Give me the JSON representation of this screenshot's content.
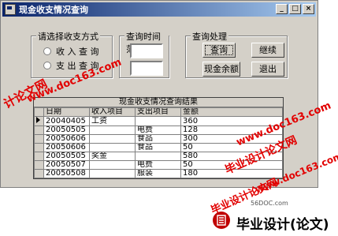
{
  "window": {
    "title": "现金收支情况查询"
  },
  "controls": {
    "minimize": "_",
    "maximize": "□",
    "close": "×"
  },
  "groups": {
    "method": "请选择收支方式",
    "range": "查询时间范围",
    "process": "查询处理"
  },
  "radios": [
    "收 入 查 询",
    "支 出 查 询"
  ],
  "buttons": {
    "query": "查询",
    "continue": "继续",
    "balance": "现金余额",
    "exit": "退出"
  },
  "grid": {
    "caption": "现金收支情况查询结果",
    "headers": [
      "日期",
      "收入项目",
      "支出项目",
      "金额"
    ],
    "rows": [
      [
        "20040405",
        "工资",
        "",
        "360"
      ],
      [
        "20050505",
        "",
        "电费",
        "128"
      ],
      [
        "20050606",
        "",
        "食品",
        "300"
      ],
      [
        "20050606",
        "",
        "食品",
        "50"
      ],
      [
        "20050505",
        "奖金",
        "",
        "580"
      ],
      [
        "20050507",
        "",
        "电费",
        "50"
      ],
      [
        "20050508",
        "",
        "服装",
        "180"
      ]
    ]
  },
  "watermarks": {
    "w1": "www.doc163.com",
    "w2": "计论文网",
    "w3": "www.doc163.com",
    "w4": "毕业设计论文网",
    "w5": "www.doc163.com",
    "w6": "毕业设计论文网"
  },
  "footer": {
    "site": "56DOC.com",
    "text": "毕业设计(论文)"
  },
  "colors": {
    "title_bar": "#0a246a",
    "watermark": "#e20000",
    "face": "#d4d0c8"
  }
}
